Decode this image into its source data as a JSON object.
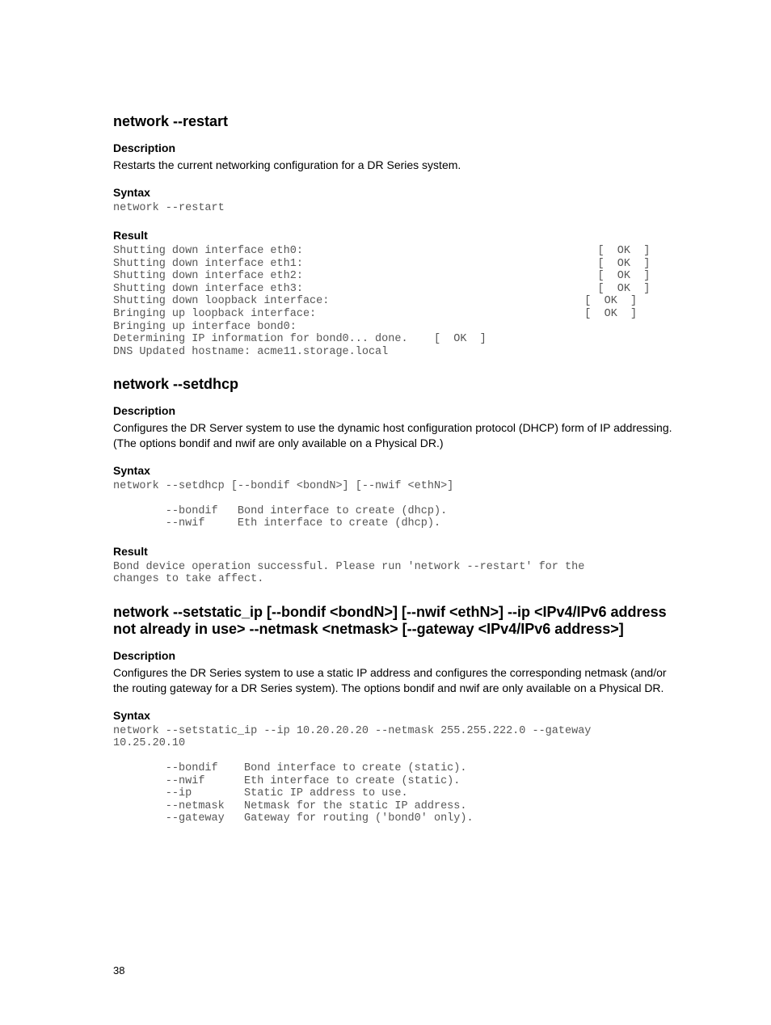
{
  "pageno": "38",
  "cmd1": {
    "title": "network --restart",
    "desc_h": "Description",
    "desc_p": "Restarts the current networking configuration for a DR Series system.",
    "syntax_h": "Syntax",
    "syntax_pre": "network --restart",
    "result_h": "Result",
    "result_pre": "Shutting down interface eth0:                                             [  OK  ]\nShutting down interface eth1:                                             [  OK  ]\nShutting down interface eth2:                                             [  OK  ]\nShutting down interface eth3:                                             [  OK  ]\nShutting down loopback interface:                                       [  OK  ]\nBringing up loopback interface:                                         [  OK  ]\nBringing up interface bond0:  \nDetermining IP information for bond0... done.    [  OK  ]\nDNS Updated hostname: acme11.storage.local"
  },
  "cmd2": {
    "title": "network --setdhcp",
    "desc_h": "Description",
    "desc_p": "Configures the DR Server system to use the dynamic host configuration protocol (DHCP) form of IP addressing. (The options bondif and nwif are only available on a Physical DR.)",
    "syntax_h": "Syntax",
    "syntax_pre": "network --setdhcp [--bondif <bondN>] [--nwif <ethN>]\n\n        --bondif   Bond interface to create (dhcp).\n        --nwif     Eth interface to create (dhcp).",
    "result_h": "Result",
    "result_pre": "Bond device operation successful. Please run 'network --restart' for the \nchanges to take affect."
  },
  "cmd3": {
    "title": "network --setstatic_ip [--bondif <bondN>] [--nwif <ethN>] --ip <IPv4/IPv6 address not already in use> --netmask <netmask> [--gateway <IPv4/IPv6 address>]",
    "desc_h": "Description",
    "desc_p": "Configures the DR Series system to use a static IP address and configures the corresponding netmask (and/or the routing gateway for a DR Series system). The options bondif and nwif are only available on a Physical DR.",
    "syntax_h": "Syntax",
    "syntax_pre": "network --setstatic_ip --ip 10.20.20.20 --netmask 255.255.222.0 --gateway \n10.25.20.10\n\n        --bondif    Bond interface to create (static).\n        --nwif      Eth interface to create (static).\n        --ip        Static IP address to use.\n        --netmask   Netmask for the static IP address.\n        --gateway   Gateway for routing ('bond0' only)."
  }
}
